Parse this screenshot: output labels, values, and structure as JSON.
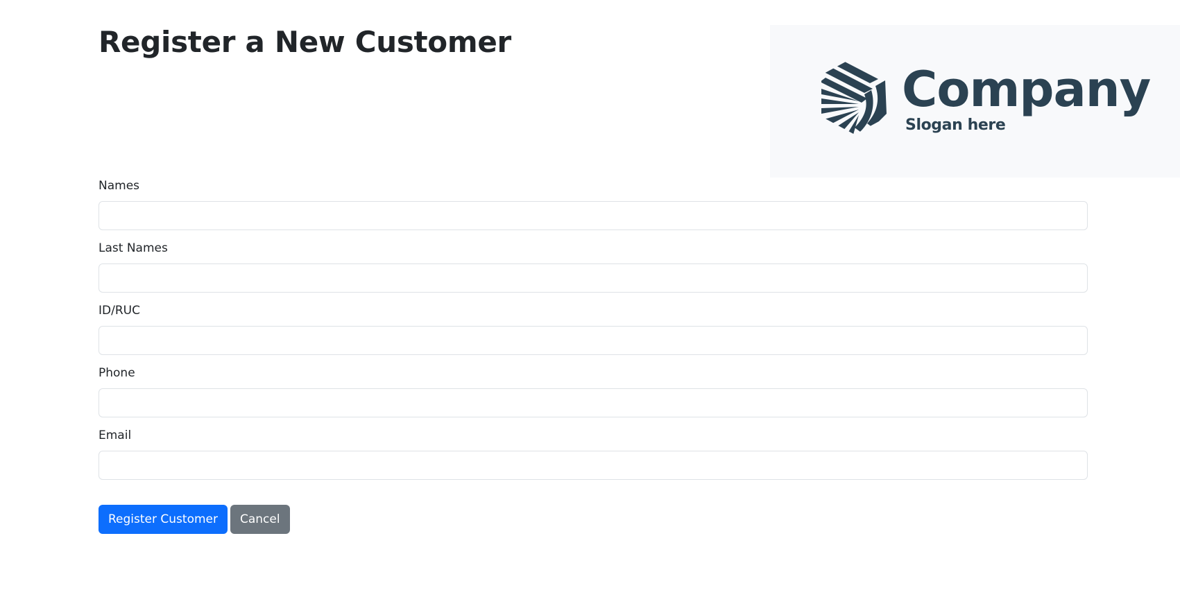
{
  "page": {
    "title": "Register a New Customer"
  },
  "logo": {
    "name": "Company",
    "slogan": "Slogan here",
    "color": "#2b4252",
    "panel_bg": "#f8f9fb"
  },
  "form": {
    "fields": [
      {
        "label": "Names",
        "value": "",
        "placeholder": ""
      },
      {
        "label": "Last Names",
        "value": "",
        "placeholder": ""
      },
      {
        "label": "ID/RUC",
        "value": "",
        "placeholder": ""
      },
      {
        "label": "Phone",
        "value": "",
        "placeholder": ""
      },
      {
        "label": "Email",
        "value": "",
        "placeholder": ""
      }
    ]
  },
  "actions": {
    "register_label": "Register Customer",
    "cancel_label": "Cancel",
    "primary_color": "#0d6efd",
    "secondary_color": "#6c757d"
  }
}
